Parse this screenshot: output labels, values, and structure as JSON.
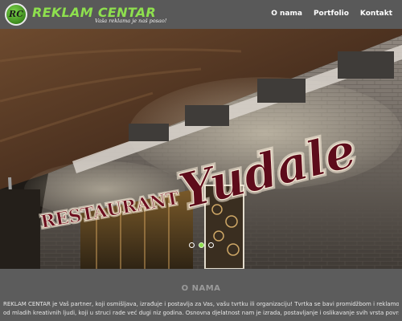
{
  "header": {
    "logo_letters": "RC",
    "brand_name": "REKLAM CENTAR",
    "tagline": "Vaša reklama je naš posao!",
    "nav": [
      {
        "label": "O nama"
      },
      {
        "label": "Portfolio"
      },
      {
        "label": "Kontakt"
      }
    ]
  },
  "hero": {
    "sign_word1": "RESTAURANT",
    "sign_word2": "Yudale",
    "slides_total": 3,
    "active_slide": 1
  },
  "about": {
    "title": "O NAMA",
    "line1": "REKLAM CENTAR je Vaš partner, koji osmišljava, izrađuje i postavlja za Vas, vašu tvrtku ili organizaciju! Tvrtka se bavi promidžbom i reklamom, a sastavljena je",
    "line2": "od mladih kreativnih ljudi, koji u struci rade već dugi niz godina. Osnovna djelatnost nam je izrada, postavljanje i oslikavanje svih vrsta površina na svim vrstama"
  },
  "colors": {
    "brand_green": "#8ee04e",
    "header_bg": "#595959",
    "sign_red": "#6b0f1f"
  }
}
